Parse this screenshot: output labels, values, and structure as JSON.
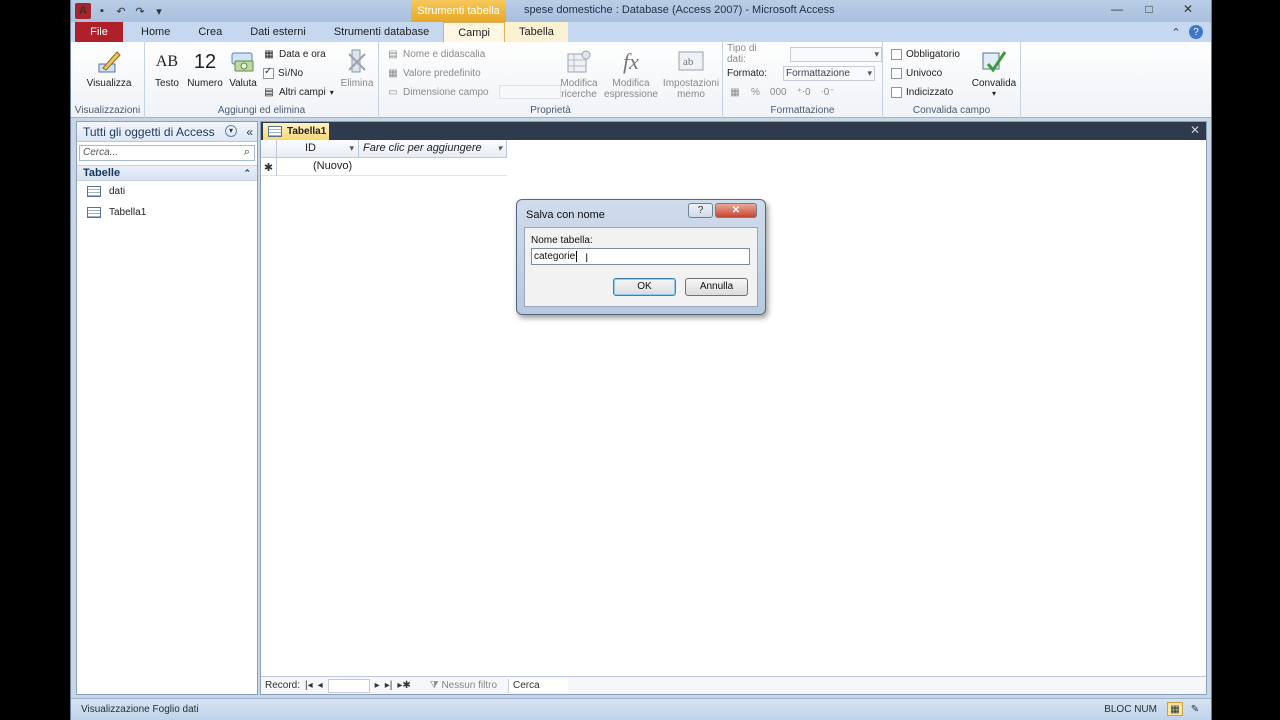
{
  "window": {
    "title": "spese domestiche : Database (Access 2007)  -  Microsoft Access",
    "context_group": "Strumenti tabella",
    "controls": {
      "minimize": "—",
      "maximize": "□",
      "close": "✕"
    }
  },
  "qat": {
    "logo": "A",
    "save": "▪",
    "undo": "↶",
    "redo": "↷",
    "customize": "▾"
  },
  "tabs": [
    {
      "label": "File"
    },
    {
      "label": "Home"
    },
    {
      "label": "Crea"
    },
    {
      "label": "Dati esterni"
    },
    {
      "label": "Strumenti database"
    },
    {
      "label": "Campi"
    },
    {
      "label": "Tabella"
    }
  ],
  "ribbon": {
    "views": {
      "label": "Visualizza",
      "group": "Visualizzazioni"
    },
    "add": {
      "text": "Testo",
      "text_icon": "AB",
      "number": "Numero",
      "number_icon": "12",
      "currency": "Valuta",
      "datetime": "Data e ora",
      "yesno": "Sì/No",
      "more": "Altri campi",
      "delete": "Elimina",
      "group": "Aggiungi ed elimina"
    },
    "props": {
      "name": "Nome e didascalia",
      "default": "Valore predefinito",
      "size": "Dimensione campo",
      "lookup1": "Modifica",
      "lookup2": "ricerche",
      "expr1": "Modifica",
      "expr2": "espressione",
      "memo1": "Impostazioni",
      "memo2": "memo",
      "group": "Proprietà"
    },
    "format": {
      "datatype_label": "Tipo di dati:",
      "datatype_value": "",
      "format_label": "Formato:",
      "format_value": "Formattazione",
      "percent": "%",
      "thousands": "000",
      "group": "Formattazione"
    },
    "validation": {
      "required": "Obbligatorio",
      "unique": "Univoco",
      "indexed": "Indicizzato",
      "validate": "Convalida",
      "group": "Convalida campo"
    }
  },
  "nav": {
    "title": "Tutti gli oggetti di Access",
    "search_placeholder": "Cerca...",
    "group": "Tabelle",
    "items": [
      "dati",
      "Tabella1"
    ]
  },
  "document": {
    "tab": "Tabella1",
    "columns": [
      "ID",
      "Fare clic per aggiungere"
    ],
    "new_row_marker": "✱",
    "new_row_value": "(Nuovo)",
    "record_label": "Record:",
    "filter": "Nessun filtro",
    "search": "Cerca"
  },
  "dialog": {
    "title": "Salva con nome",
    "help": "?",
    "close": "✕",
    "label": "Nome tabella:",
    "value": "categorie",
    "ok": "OK",
    "cancel": "Annulla"
  },
  "status": {
    "left": "Visualizzazione Foglio dati",
    "right": "BLOC NUM"
  }
}
